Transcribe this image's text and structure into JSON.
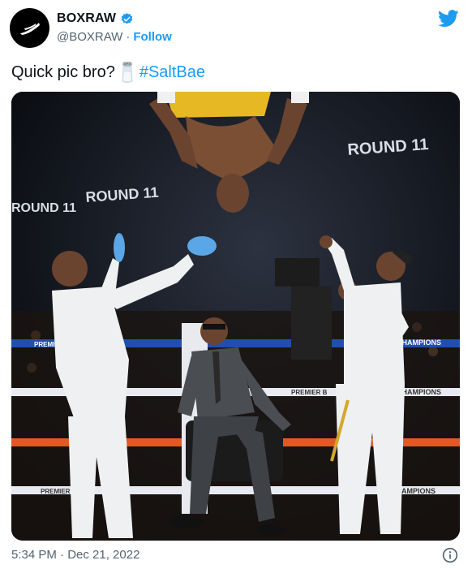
{
  "author": {
    "display_name": "BOXRAW",
    "handle": "@BOXRAW",
    "separator": "·",
    "follow_label": "Follow"
  },
  "tweet": {
    "text": "Quick pic bro?",
    "emoji": "salt-shaker",
    "hashtag": "#SaltBae"
  },
  "media": {
    "screen_labels": [
      "ROUND 11",
      "ROUND 11",
      "ROUND 11"
    ],
    "ring_banners": [
      "PREMIER",
      "CHAMPIONS",
      "PREMIER B",
      "CHAMPIONS",
      "PREMIER BO",
      "CHAMPIONS"
    ]
  },
  "footer": {
    "timestamp": "5:34 PM · Dec 21, 2022"
  },
  "colors": {
    "accent": "#1d9bf0",
    "text": "#0f1419",
    "muted": "#536471"
  }
}
